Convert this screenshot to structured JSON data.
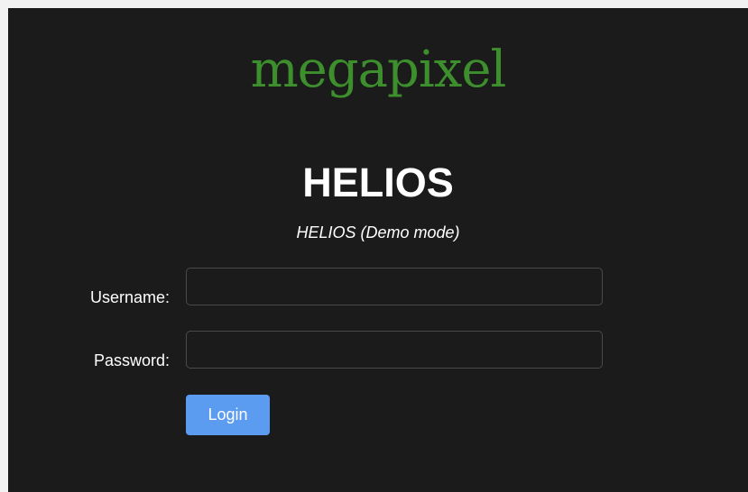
{
  "brand": {
    "logo_text": "megapixel",
    "logo_color": "#3c8f2c"
  },
  "page": {
    "title": "HELIOS",
    "subtitle": "HELIOS (Demo mode)"
  },
  "form": {
    "username_label": "Username:",
    "username_value": "",
    "password_label": "Password:",
    "password_value": "",
    "login_label": "Login",
    "login_color": "#5b9bf0"
  }
}
